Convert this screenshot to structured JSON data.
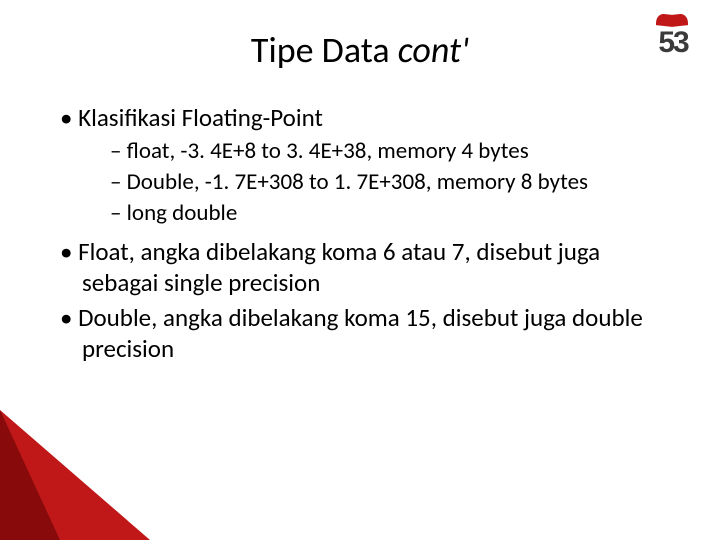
{
  "title_plain": "Tipe Data ",
  "title_italic": "cont'",
  "logo_text": "53",
  "bullets": {
    "b1": "Klasifikasi Floating-Point",
    "b1_sub1": "float, -3. 4E+8 to 3. 4E+38, memory 4 bytes",
    "b1_sub2": "Double, -1. 7E+308 to 1. 7E+308, memory 8 bytes",
    "b1_sub3": "long double",
    "b2": "Float, angka dibelakang koma 6 atau 7, disebut juga sebagai single precision",
    "b3": "Double, angka dibelakang koma 15, disebut juga double precision"
  }
}
